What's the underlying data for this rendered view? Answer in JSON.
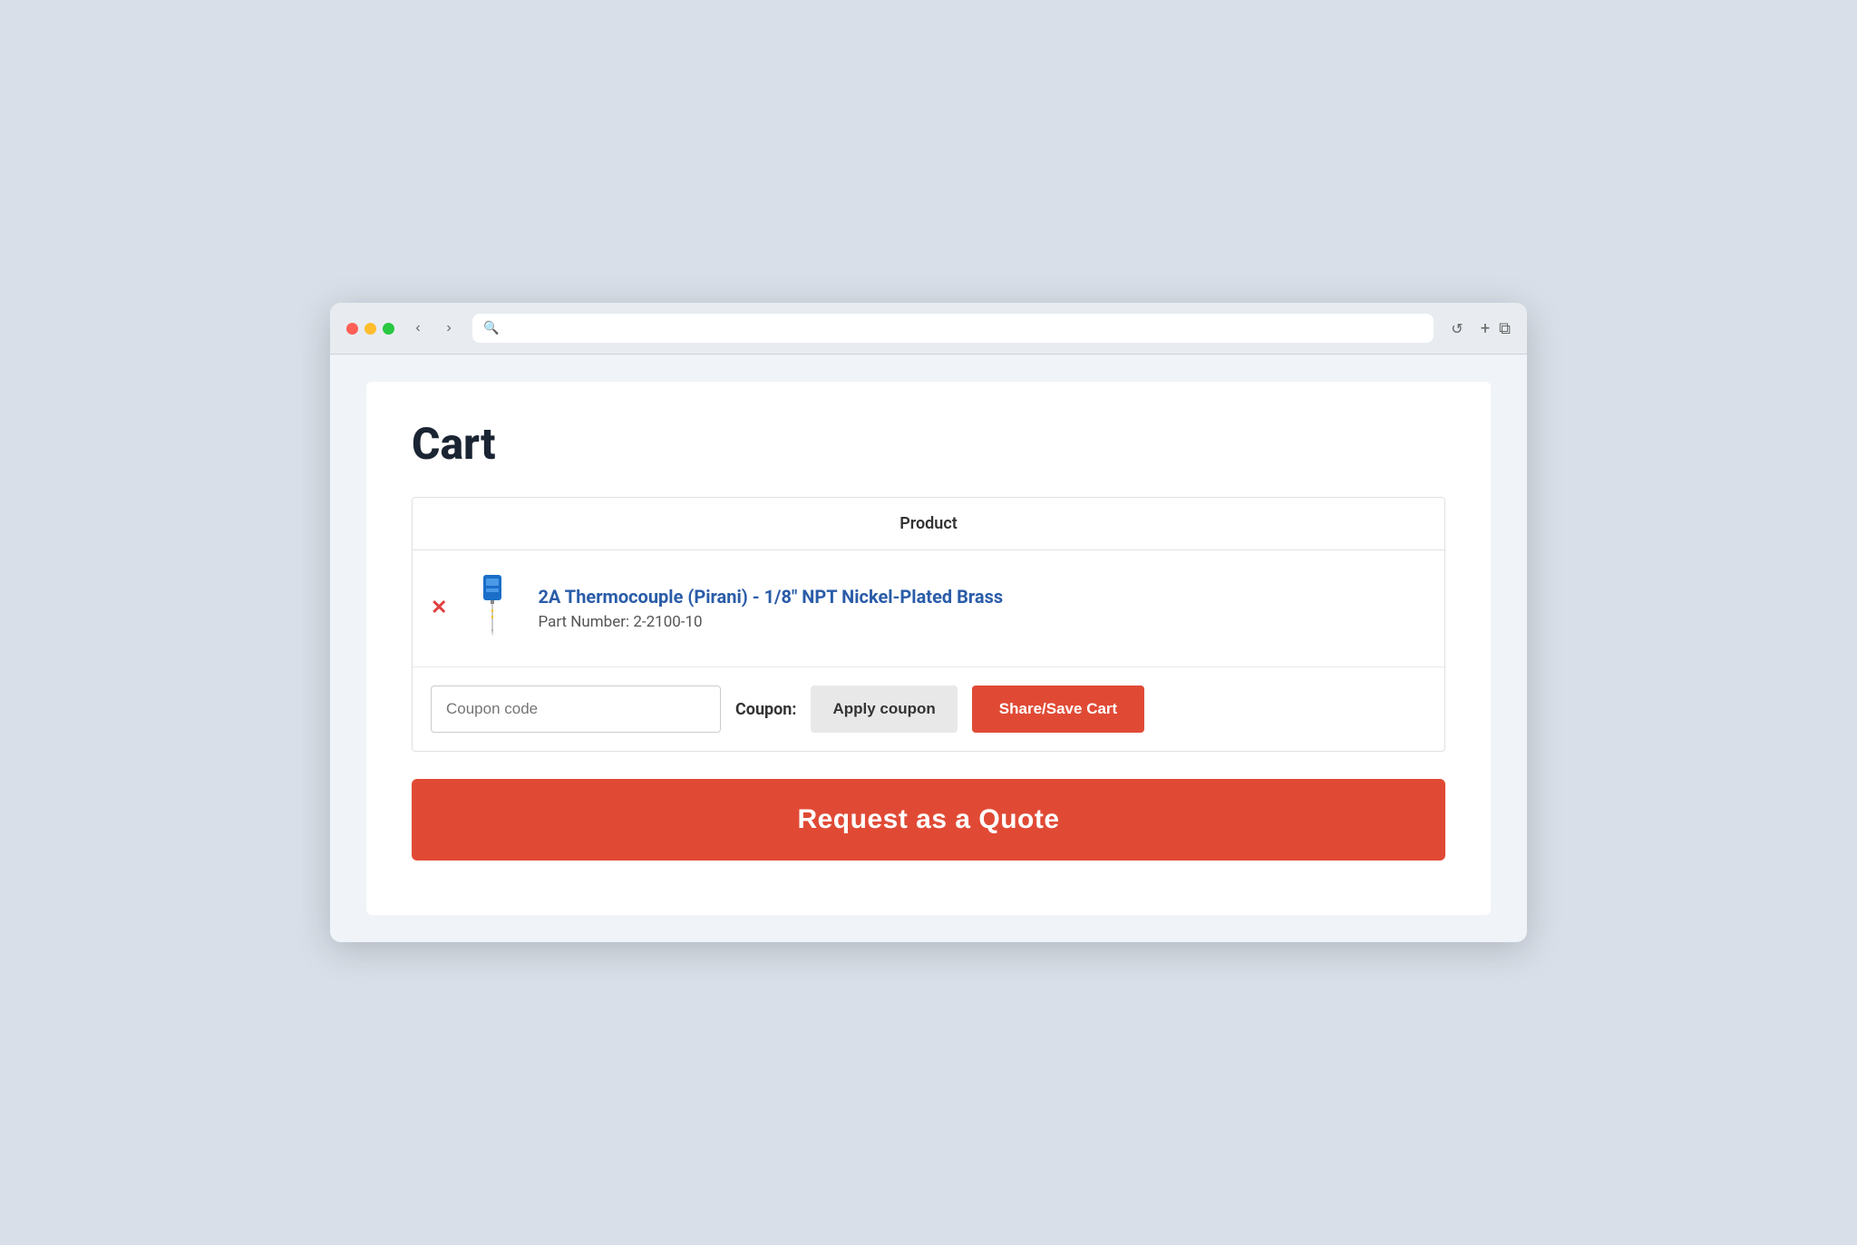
{
  "browser": {
    "traffic_lights": [
      "red",
      "yellow",
      "green"
    ],
    "nav_back_label": "‹",
    "nav_forward_label": "›",
    "search_placeholder": "🔍",
    "reload_label": "↺",
    "new_tab_label": "+",
    "duplicate_label": "⧉"
  },
  "page": {
    "title": "Cart",
    "table": {
      "column_header": "Product",
      "rows": [
        {
          "product_name": "2A Thermocouple (Pirani) - 1/8″ NPT Nickel-Plated Brass",
          "part_number_label": "Part Number: 2-2100-10"
        }
      ]
    },
    "coupon": {
      "input_placeholder": "Coupon code",
      "label": "Coupon:",
      "apply_button_label": "Apply coupon",
      "share_save_button_label": "Share/Save Cart"
    },
    "request_quote_button_label": "Request as a Quote"
  }
}
